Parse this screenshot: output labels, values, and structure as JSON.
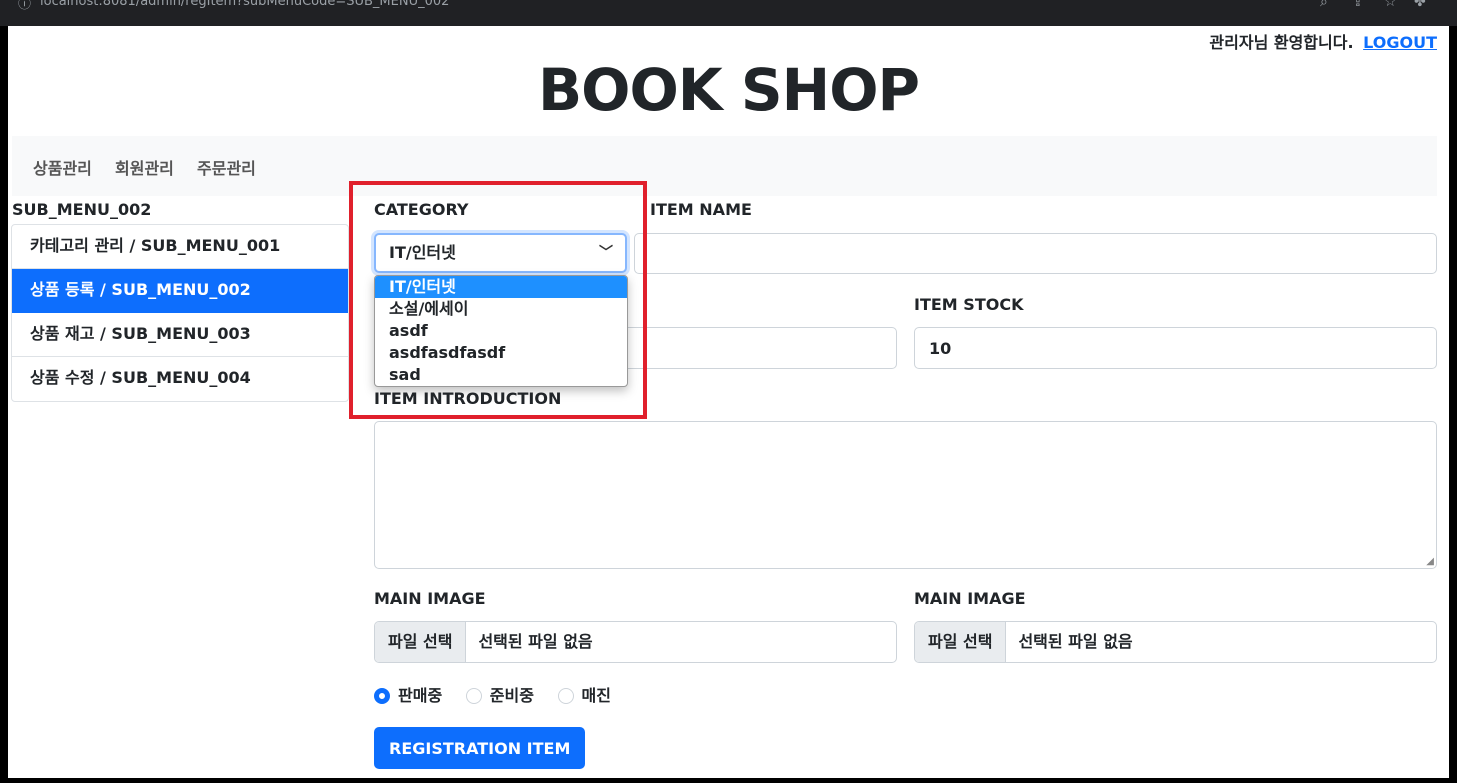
{
  "browser": {
    "url": "localhost:8081/admin/regItem?subMenuCode=SUB_MENU_002"
  },
  "header": {
    "welcome": "관리자님 환영합니다.",
    "logout": "LOGOUT",
    "title": "BOOK SHOP"
  },
  "nav": {
    "items": [
      "상품관리",
      "회원관리",
      "주문관리"
    ]
  },
  "sidebar": {
    "title": "SUB_MENU_002",
    "items": [
      "카테고리 관리 / SUB_MENU_001",
      "상품 등록 / SUB_MENU_002",
      "상품 재고 / SUB_MENU_003",
      "상품 수정 / SUB_MENU_004"
    ],
    "active_index": 1
  },
  "form": {
    "category_label": "CATEGORY",
    "category_selected": "IT/인터넷",
    "category_options": [
      "IT/인터넷",
      "소설/에세이",
      "asdf",
      "asdfasdfasdf",
      "sad"
    ],
    "item_name_label": "ITEM NAME",
    "item_name_value": "",
    "item_price_value": "",
    "item_stock_label": "ITEM STOCK",
    "item_stock_value": "10",
    "intro_label": "ITEM INTRODUCTION",
    "main_image_label": "MAIN IMAGE",
    "sub_image_label": "MAIN IMAGE",
    "file_button": "파일 선택",
    "file_none": "선택된 파일 없음",
    "status_options": [
      "판매중",
      "준비중",
      "매진"
    ],
    "status_selected": 0,
    "submit": "REGISTRATION ITEM"
  },
  "colors": {
    "accent": "#0d6efd",
    "highlight_box": "#e0202c",
    "selected_option": "#1e90ff"
  }
}
